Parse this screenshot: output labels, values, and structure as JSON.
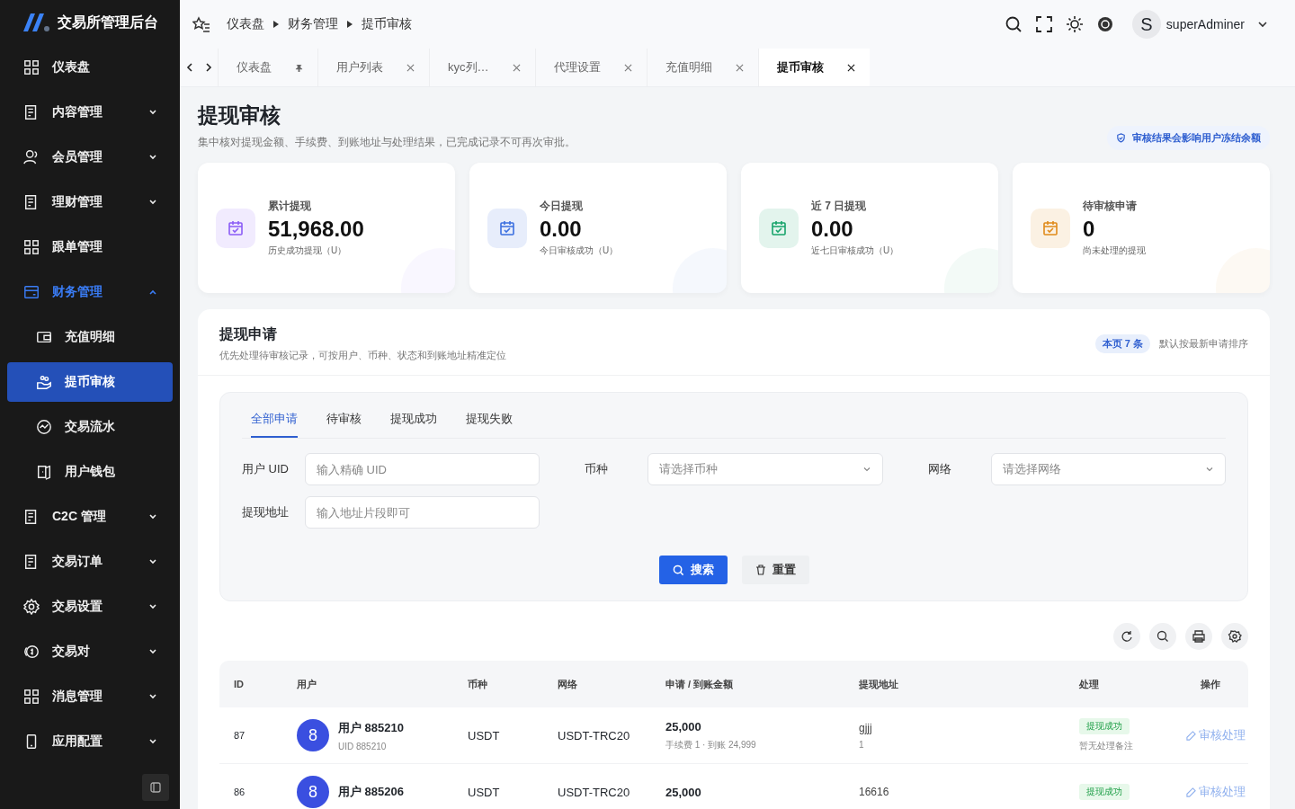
{
  "brand": {
    "title": "交易所管理后台"
  },
  "sidebar": {
    "items": [
      {
        "label": "仪表盘",
        "selected": false
      },
      {
        "label": "内容管理",
        "selected": false,
        "expanded": false
      },
      {
        "label": "会员管理",
        "selected": false,
        "expanded": false
      },
      {
        "label": "理财管理",
        "selected": false,
        "expanded": false
      },
      {
        "label": "跟单管理",
        "selected": false
      },
      {
        "label": "财务管理",
        "selected": true,
        "expanded": true,
        "children": [
          {
            "label": "充值明细",
            "selected": false
          },
          {
            "label": "提币审核",
            "selected": true
          },
          {
            "label": "交易流水",
            "selected": false
          },
          {
            "label": "用户钱包",
            "selected": false
          }
        ]
      },
      {
        "label": "C2C 管理",
        "selected": false,
        "expanded": false
      },
      {
        "label": "交易订单",
        "selected": false,
        "expanded": false
      },
      {
        "label": "交易设置",
        "selected": false,
        "expanded": false
      },
      {
        "label": "交易对",
        "selected": false,
        "expanded": false
      },
      {
        "label": "消息管理",
        "selected": false,
        "expanded": false
      },
      {
        "label": "应用配置",
        "selected": false,
        "expanded": false
      }
    ]
  },
  "breadcrumb": [
    "仪表盘",
    "财务管理",
    "提币审核"
  ],
  "user": {
    "initial": "S",
    "name": "superAdminer"
  },
  "tabs": [
    {
      "label": "仪表盘",
      "selected": false,
      "pinned": true
    },
    {
      "label": "用户列表",
      "selected": false,
      "pinned": false
    },
    {
      "label": "kyc列…",
      "selected": false,
      "pinned": false
    },
    {
      "label": "代理设置",
      "selected": false,
      "pinned": false
    },
    {
      "label": "充值明细",
      "selected": false,
      "pinned": false
    },
    {
      "label": "提币审核",
      "selected": true,
      "pinned": false
    }
  ],
  "page": {
    "title": "提现审核",
    "subtitle": "集中核对提现金额、手续费、到账地址与处理结果，已完成记录不可再次审批。",
    "notice": "审核结果会影响用户冻结余额"
  },
  "stats": [
    {
      "label": "累计提现",
      "value": "51,968.00",
      "note": "历史成功提现（U）",
      "color": "#8b5cf6"
    },
    {
      "label": "今日提现",
      "value": "0.00",
      "note": "今日审核成功（U）",
      "color": "#3b6fe0"
    },
    {
      "label": "近 7 日提现",
      "value": "0.00",
      "note": "近七日审核成功（U）",
      "color": "#16a36a"
    },
    {
      "label": "待审核申请",
      "value": "0",
      "note": "尚未处理的提现",
      "color": "#e08a1a"
    }
  ],
  "panel": {
    "title": "提现申请",
    "subtitle": "优先处理待审核记录，可按用户、币种、状态和到账地址精准定位",
    "count": "本页 7 条",
    "sort_note": "默认按最新申请排序"
  },
  "filter_tabs": [
    {
      "label": "全部申请",
      "selected": true
    },
    {
      "label": "待审核",
      "selected": false
    },
    {
      "label": "提现成功",
      "selected": false
    },
    {
      "label": "提现失败",
      "selected": false
    }
  ],
  "fields": [
    {
      "label": "用户 UID",
      "placeholder": "输入精确 UID",
      "kind": "input"
    },
    {
      "label": "币种",
      "placeholder": "请选择币种",
      "kind": "select"
    },
    {
      "label": "网络",
      "placeholder": "请选择网络",
      "kind": "select"
    },
    {
      "label": "提现地址",
      "placeholder": "输入地址片段即可",
      "kind": "input"
    }
  ],
  "buttons": {
    "search": "搜索",
    "reset": "重置"
  },
  "table": {
    "columns": [
      "ID",
      "用户",
      "币种",
      "网络",
      "申请 / 到账金额",
      "提现地址",
      "处理",
      "操作"
    ],
    "rows": [
      {
        "id": "87",
        "avatar": "8",
        "name": "用户 885210",
        "uid": "UID 885210",
        "coin": "USDT",
        "network": "USDT-TRC20",
        "amount": "25,000",
        "fee": "手续费 1 · 到账 24,999",
        "address": "gjjj",
        "address_note": "1",
        "status": "提现成功",
        "remark": "暂无处理备注",
        "action": "审核处理"
      },
      {
        "id": "86",
        "avatar": "8",
        "name": "用户 885206",
        "coin": "USDT",
        "network": "USDT-TRC20",
        "amount": "25,000",
        "address": "16616",
        "status": "提现成功",
        "action": "审核处理"
      }
    ]
  }
}
